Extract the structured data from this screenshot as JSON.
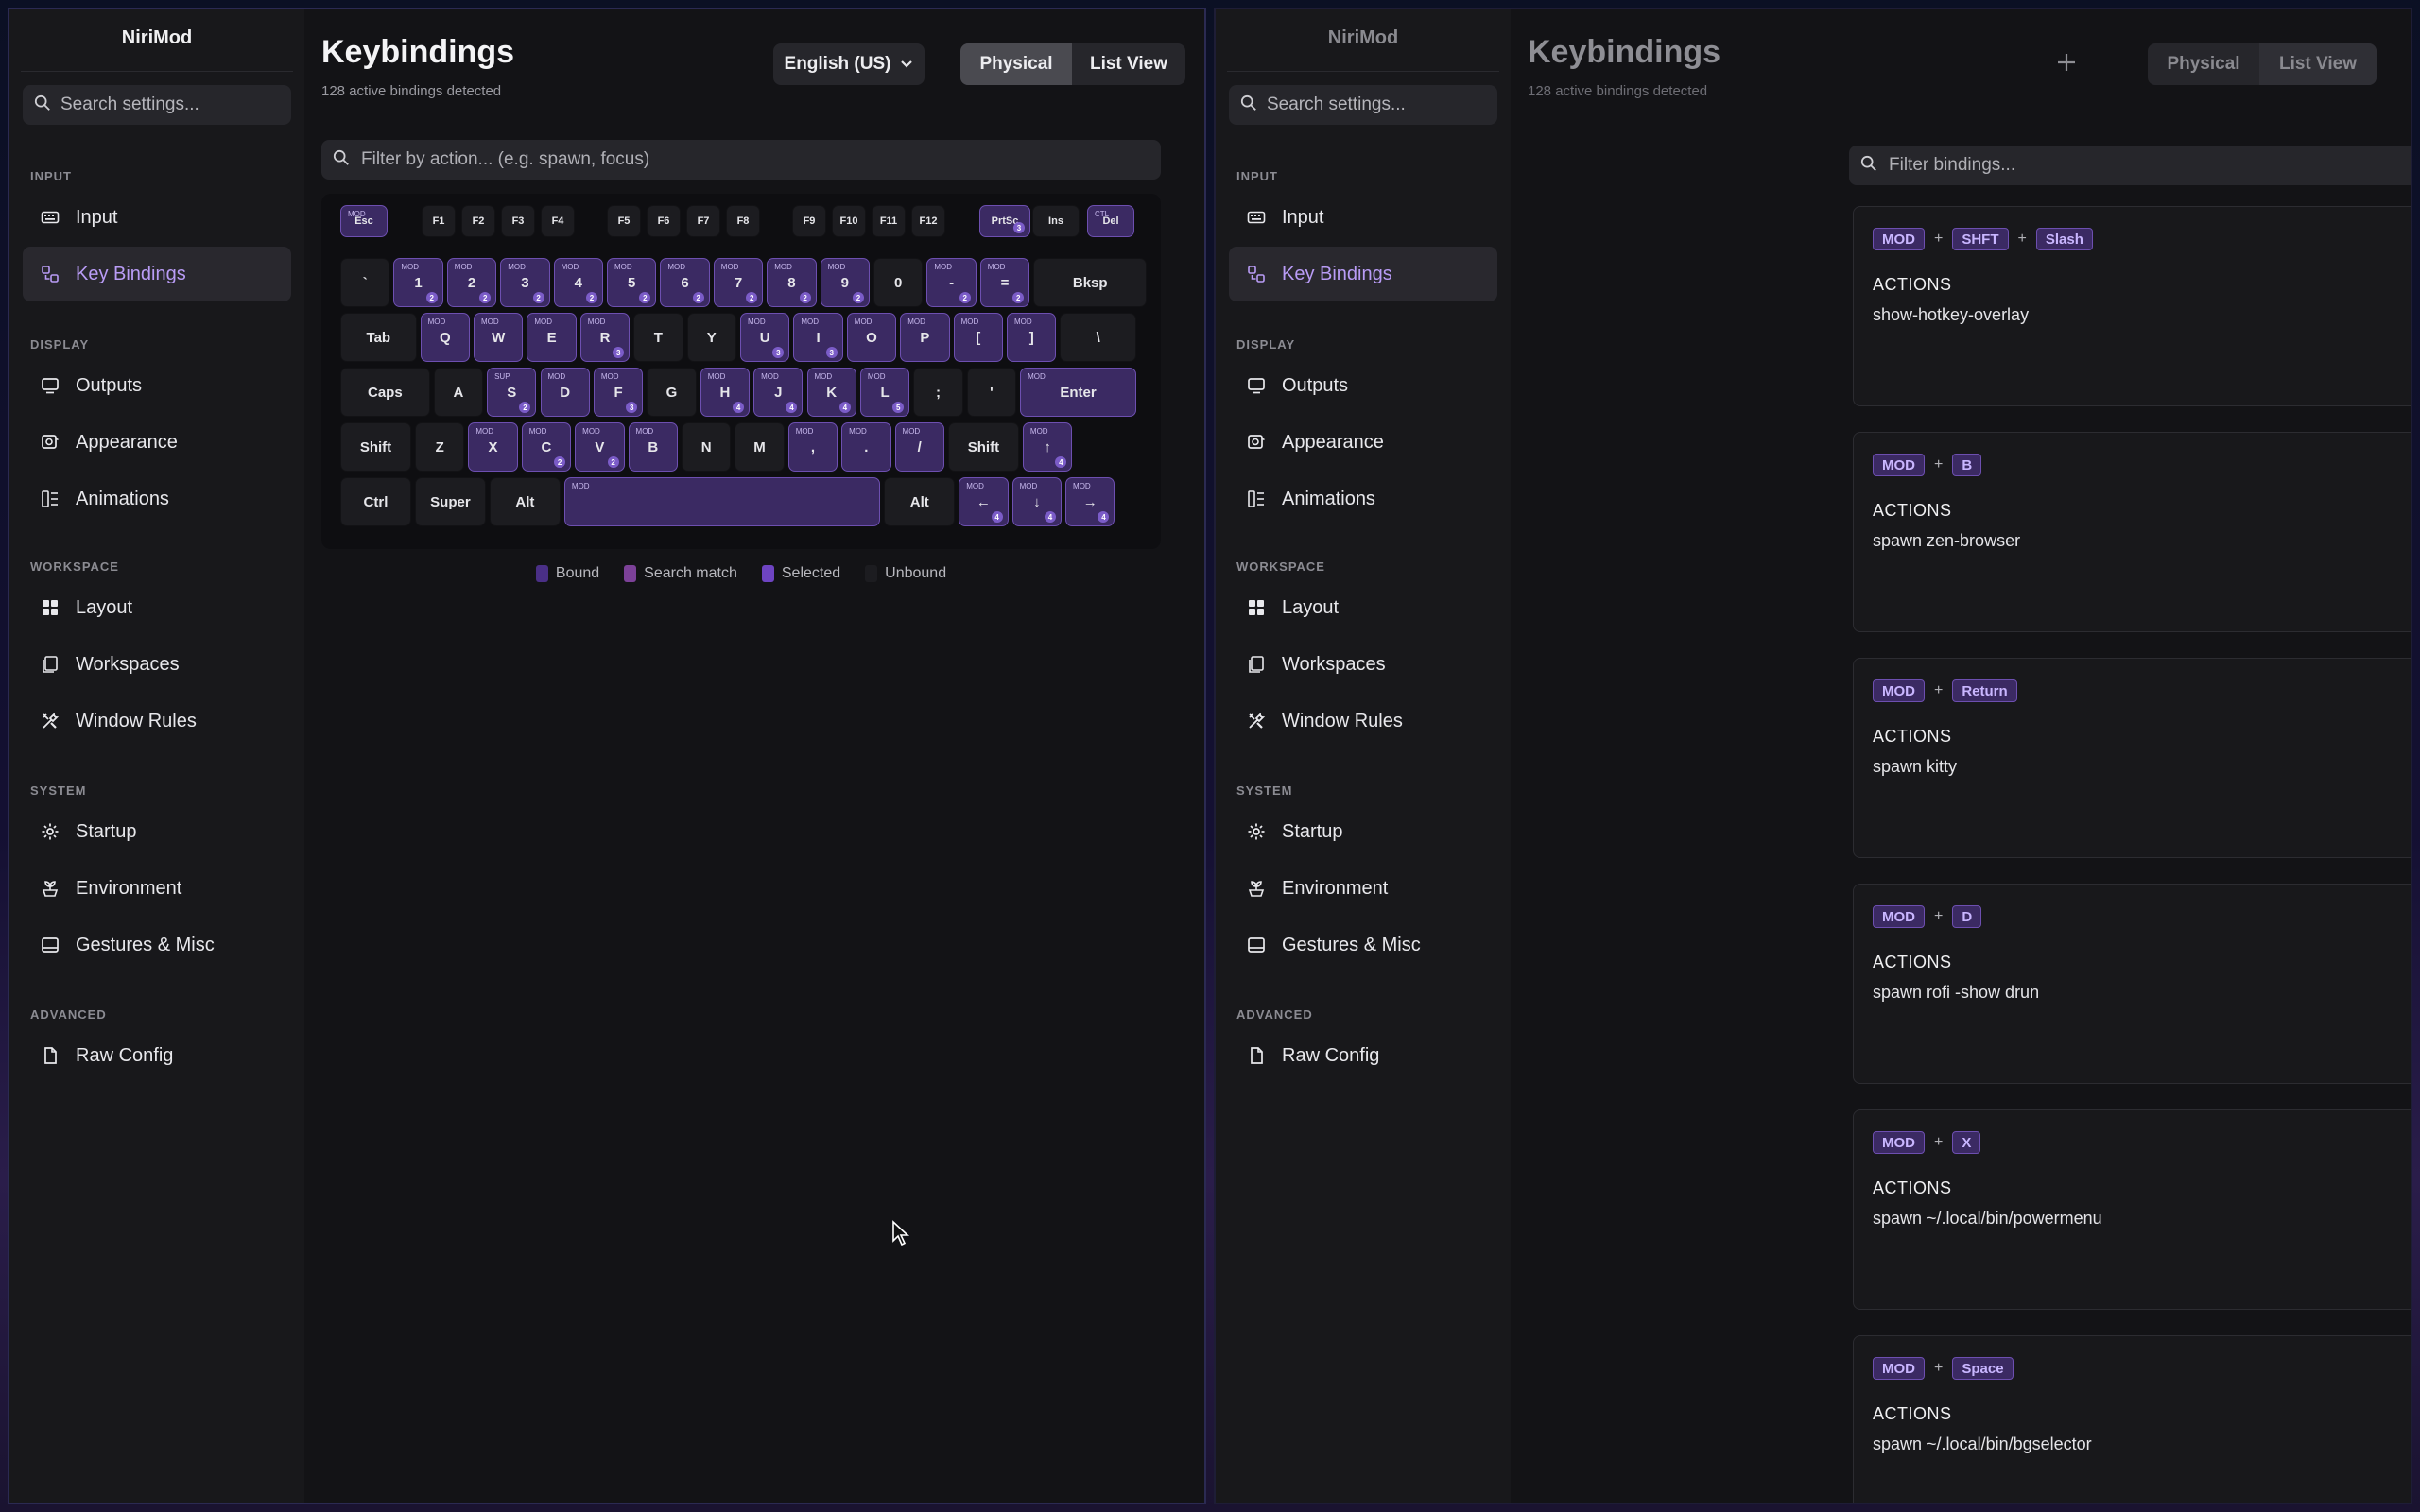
{
  "app_title": "NiriMod",
  "sidebar": {
    "search_placeholder": "Search settings...",
    "sections": [
      {
        "label": "INPUT",
        "items": [
          {
            "label": "Input",
            "icon": "keyboard-icon"
          },
          {
            "label": "Key Bindings",
            "icon": "keybindings-icon",
            "active": true
          }
        ]
      },
      {
        "label": "DISPLAY",
        "items": [
          {
            "label": "Outputs",
            "icon": "monitor-icon"
          },
          {
            "label": "Appearance",
            "icon": "palette-icon"
          },
          {
            "label": "Animations",
            "icon": "animation-icon"
          }
        ]
      },
      {
        "label": "WORKSPACE",
        "items": [
          {
            "label": "Layout",
            "icon": "grid-icon"
          },
          {
            "label": "Workspaces",
            "icon": "workspaces-icon"
          },
          {
            "label": "Window Rules",
            "icon": "tools-icon"
          }
        ]
      },
      {
        "label": "SYSTEM",
        "items": [
          {
            "label": "Startup",
            "icon": "gear-icon"
          },
          {
            "label": "Environment",
            "icon": "environment-icon"
          },
          {
            "label": "Gestures & Misc",
            "icon": "gestures-icon"
          }
        ]
      },
      {
        "label": "ADVANCED",
        "items": [
          {
            "label": "Raw Config",
            "icon": "file-icon"
          }
        ]
      }
    ]
  },
  "physical_view": {
    "title": "Keybindings",
    "subtitle": "128 active bindings detected",
    "layout_select": "English (US)",
    "view_toggle": {
      "physical": "Physical",
      "list": "List View",
      "selected": "Physical"
    },
    "filter_placeholder": "Filter by action... (e.g. spawn, focus)",
    "legend": [
      {
        "label": "Bound",
        "color": "#4a2f86"
      },
      {
        "label": "Search match",
        "color": "#7c4198"
      },
      {
        "label": "Selected",
        "color": "#6e44c2"
      },
      {
        "label": "Unbound",
        "color": "#1c1c20"
      }
    ],
    "keyboard_rows": [
      [
        {
          "label": "Esc",
          "mod": "MOD",
          "bound": true,
          "small": true
        },
        {
          "label": "F1",
          "small": true
        },
        {
          "label": "F2",
          "small": true
        },
        {
          "label": "F3",
          "small": true
        },
        {
          "label": "F4",
          "small": true
        },
        {
          "label": "F5",
          "small": true
        },
        {
          "label": "F6",
          "small": true
        },
        {
          "label": "F7",
          "small": true
        },
        {
          "label": "F8",
          "small": true
        },
        {
          "label": "F9",
          "small": true
        },
        {
          "label": "F10",
          "small": true
        },
        {
          "label": "F11",
          "small": true
        },
        {
          "label": "F12",
          "small": true
        },
        {
          "label": "PrtSc",
          "bound": true,
          "count": "3",
          "small": true
        },
        {
          "label": "Ins",
          "small": true
        },
        {
          "label": "Del",
          "mod": "CTL",
          "bound": true,
          "small": true
        }
      ],
      [
        {
          "label": "`"
        },
        {
          "label": "1",
          "mod": "MOD",
          "bound": true,
          "count": "2"
        },
        {
          "label": "2",
          "mod": "MOD",
          "bound": true,
          "count": "2"
        },
        {
          "label": "3",
          "mod": "MOD",
          "bound": true,
          "count": "2"
        },
        {
          "label": "4",
          "mod": "MOD",
          "bound": true,
          "count": "2"
        },
        {
          "label": "5",
          "mod": "MOD",
          "bound": true,
          "count": "2"
        },
        {
          "label": "6",
          "mod": "MOD",
          "bound": true,
          "count": "2"
        },
        {
          "label": "7",
          "mod": "MOD",
          "bound": true,
          "count": "2"
        },
        {
          "label": "8",
          "mod": "MOD",
          "bound": true,
          "count": "2"
        },
        {
          "label": "9",
          "mod": "MOD",
          "bound": true,
          "count": "2"
        },
        {
          "label": "0"
        },
        {
          "label": "-",
          "mod": "MOD",
          "bound": true,
          "count": "2"
        },
        {
          "label": "=",
          "mod": "MOD",
          "bound": true,
          "count": "2"
        },
        {
          "label": "Bksp"
        }
      ],
      [
        {
          "label": "Tab"
        },
        {
          "label": "Q",
          "mod": "MOD",
          "bound": true
        },
        {
          "label": "W",
          "mod": "MOD",
          "bound": true
        },
        {
          "label": "E",
          "mod": "MOD",
          "bound": true
        },
        {
          "label": "R",
          "mod": "MOD",
          "bound": true,
          "count": "3"
        },
        {
          "label": "T"
        },
        {
          "label": "Y"
        },
        {
          "label": "U",
          "mod": "MOD",
          "bound": true,
          "count": "3"
        },
        {
          "label": "I",
          "mod": "MOD",
          "bound": true,
          "count": "3"
        },
        {
          "label": "O",
          "mod": "MOD",
          "bound": true
        },
        {
          "label": "P",
          "mod": "MOD",
          "bound": true
        },
        {
          "label": "[",
          "mod": "MOD",
          "bound": true
        },
        {
          "label": "]",
          "mod": "MOD",
          "bound": true
        },
        {
          "label": "\\"
        }
      ],
      [
        {
          "label": "Caps"
        },
        {
          "label": "A"
        },
        {
          "label": "S",
          "mod": "SUP",
          "bound": true,
          "count": "2"
        },
        {
          "label": "D",
          "mod": "MOD",
          "bound": true
        },
        {
          "label": "F",
          "mod": "MOD",
          "bound": true,
          "count": "3"
        },
        {
          "label": "G"
        },
        {
          "label": "H",
          "mod": "MOD",
          "bound": true,
          "count": "4"
        },
        {
          "label": "J",
          "mod": "MOD",
          "bound": true,
          "count": "4"
        },
        {
          "label": "K",
          "mod": "MOD",
          "bound": true,
          "count": "4"
        },
        {
          "label": "L",
          "mod": "MOD",
          "bound": true,
          "count": "5"
        },
        {
          "label": ";"
        },
        {
          "label": "'"
        },
        {
          "label": "Enter",
          "mod": "MOD",
          "bound": true
        }
      ],
      [
        {
          "label": "Shift"
        },
        {
          "label": "Z"
        },
        {
          "label": "X",
          "mod": "MOD",
          "bound": true
        },
        {
          "label": "C",
          "mod": "MOD",
          "bound": true,
          "count": "2"
        },
        {
          "label": "V",
          "mod": "MOD",
          "bound": true,
          "count": "2"
        },
        {
          "label": "B",
          "mod": "MOD",
          "bound": true
        },
        {
          "label": "N"
        },
        {
          "label": "M"
        },
        {
          "label": ",",
          "mod": "MOD",
          "bound": true
        },
        {
          "label": ".",
          "mod": "MOD",
          "bound": true
        },
        {
          "label": "/",
          "mod": "MOD",
          "bound": true
        },
        {
          "label": "Shift"
        },
        {
          "label": "↑",
          "mod": "MOD",
          "bound": true,
          "count": "4"
        }
      ],
      [
        {
          "label": "Ctrl"
        },
        {
          "label": "Super"
        },
        {
          "label": "Alt"
        },
        {
          "label": "",
          "mod": "MOD",
          "bound": true
        },
        {
          "label": "Alt"
        },
        {
          "label": "←",
          "mod": "MOD",
          "bound": true,
          "count": "4"
        },
        {
          "label": "↓",
          "mod": "MOD",
          "bound": true,
          "count": "4"
        },
        {
          "label": "→",
          "mod": "MOD",
          "bound": true,
          "count": "4"
        }
      ]
    ]
  },
  "list_view": {
    "title": "Keybindings",
    "subtitle": "128 active bindings detected",
    "view_toggle": {
      "physical": "Physical",
      "list": "List View",
      "selected": "List View"
    },
    "filter_placeholder": "Filter bindings...",
    "actions_label": "ACTIONS",
    "bindings": [
      {
        "keys": [
          "MOD",
          "SHFT",
          "Slash"
        ],
        "action": "show-hotkey-overlay"
      },
      {
        "keys": [
          "MOD",
          "B"
        ],
        "action": "spawn zen-browser"
      },
      {
        "keys": [
          "MOD",
          "Return"
        ],
        "action": "spawn kitty"
      },
      {
        "keys": [
          "MOD",
          "D"
        ],
        "action": "spawn rofi -show drun"
      },
      {
        "keys": [
          "MOD",
          "X"
        ],
        "action": "spawn ~/.local/bin/powermenu"
      },
      {
        "keys": [
          "MOD",
          "Space"
        ],
        "action": "spawn ~/.local/bin/bgselector"
      }
    ]
  }
}
